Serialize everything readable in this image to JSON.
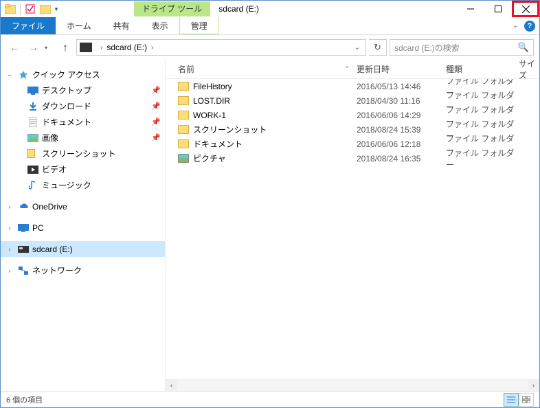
{
  "window": {
    "title": "sdcard (E:)",
    "contextual_tab": "ドライブ ツール"
  },
  "ribbon": {
    "file": "ファイル",
    "home": "ホーム",
    "share": "共有",
    "view": "表示",
    "manage": "管理"
  },
  "address": {
    "segment": "sdcard (E:)",
    "search_placeholder": "sdcard (E:)の検索"
  },
  "columns": {
    "name": "名前",
    "date": "更新日時",
    "type": "種類",
    "size": "サイズ"
  },
  "tree": {
    "quick_access": "クイック アクセス",
    "desktop": "デスクトップ",
    "downloads": "ダウンロード",
    "documents": "ドキュメント",
    "pictures": "画像",
    "screenshots": "スクリーンショット",
    "videos": "ビデオ",
    "music": "ミュージック",
    "onedrive": "OneDrive",
    "pc": "PC",
    "sdcard": "sdcard (E:)",
    "network": "ネットワーク"
  },
  "files": [
    {
      "name": "FileHistory",
      "date": "2016/05/13 14:46",
      "type": "ファイル フォルダー",
      "icon": "folder"
    },
    {
      "name": "LOST.DIR",
      "date": "2018/04/30 11:16",
      "type": "ファイル フォルダー",
      "icon": "folder"
    },
    {
      "name": "WORK-1",
      "date": "2016/06/06 14:29",
      "type": "ファイル フォルダー",
      "icon": "folder"
    },
    {
      "name": "スクリーンショット",
      "date": "2018/08/24 15:39",
      "type": "ファイル フォルダー",
      "icon": "folder"
    },
    {
      "name": "ドキュメント",
      "date": "2016/06/06 12:18",
      "type": "ファイル フォルダー",
      "icon": "folder"
    },
    {
      "name": "ピクチャ",
      "date": "2018/08/24 16:35",
      "type": "ファイル フォルダー",
      "icon": "picfolder"
    }
  ],
  "status": {
    "item_count": "6 個の項目"
  }
}
